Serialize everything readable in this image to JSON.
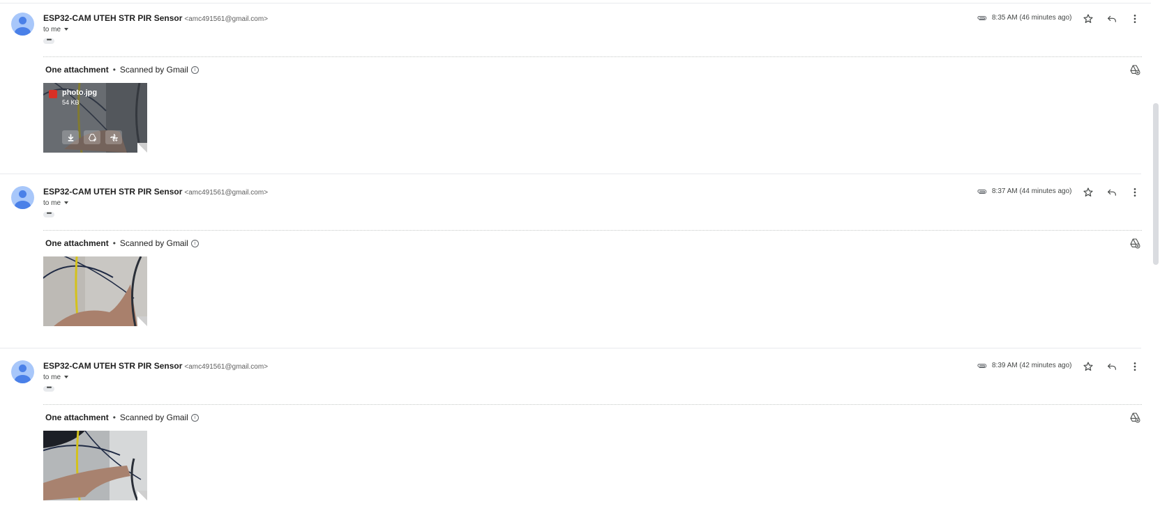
{
  "messages": [
    {
      "sender_name": "ESP32-CAM UTEH STR PIR Sensor",
      "sender_email": "<amc491561@gmail.com>",
      "recipient": "to me",
      "time": "8:35 AM (46 minutes ago)",
      "attachment_title": "One attachment",
      "scanned": "Scanned by Gmail",
      "file_name": "photo.jpg",
      "file_size": "54 KB",
      "show_overlay": true
    },
    {
      "sender_name": "ESP32-CAM UTEH STR PIR Sensor",
      "sender_email": "<amc491561@gmail.com>",
      "recipient": "to me",
      "time": "8:37 AM (44 minutes ago)",
      "attachment_title": "One attachment",
      "scanned": "Scanned by Gmail",
      "show_overlay": false
    },
    {
      "sender_name": "ESP32-CAM UTEH STR PIR Sensor",
      "sender_email": "<amc491561@gmail.com>",
      "recipient": "to me",
      "time": "8:39 AM (42 minutes ago)",
      "attachment_title": "One attachment",
      "scanned": "Scanned by Gmail",
      "show_overlay": false
    }
  ],
  "separator": "•",
  "icons": {
    "attachment": "paperclip-icon",
    "star": "star-icon",
    "reply": "reply-icon",
    "more": "more-vert-icon",
    "drive_add": "add-to-drive-icon",
    "download": "download-icon",
    "photos_add": "add-to-photos-icon"
  },
  "colors": {
    "avatar_bg": "#a8c7fa",
    "avatar_fg": "#4a80e8",
    "image_badge": "#d93025"
  }
}
